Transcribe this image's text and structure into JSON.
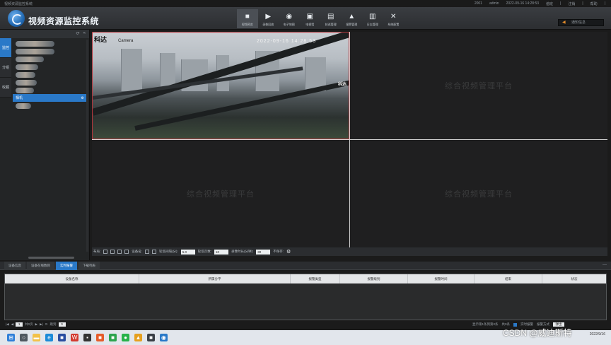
{
  "window": {
    "title": "视频资源监控系统",
    "status_items": [
      "2001",
      "admin",
      "2022-09-16 14:28:53",
      "值班",
      "|",
      "注销",
      "|",
      "帮助",
      "|"
    ]
  },
  "header": {
    "app_title": "视频资源监控系统",
    "nav": [
      {
        "label": "视频预览",
        "icon": "camera-icon"
      },
      {
        "label": "录像回放",
        "icon": "playback-icon"
      },
      {
        "label": "电子地图",
        "icon": "map-pin-icon"
      },
      {
        "label": "电视墙",
        "icon": "tv-wall-icon"
      },
      {
        "label": "轮巡管理",
        "icon": "cycle-icon"
      },
      {
        "label": "报警管理",
        "icon": "alarm-icon"
      },
      {
        "label": "日志管理",
        "icon": "log-icon"
      },
      {
        "label": "系统配置",
        "icon": "tools-icon"
      }
    ],
    "search_placeholder": "通知信息"
  },
  "left_panel": {
    "tabs": [
      "监控",
      "分组",
      "收藏"
    ],
    "selected_tree_label": "相机",
    "tree_rows": 9
  },
  "video": {
    "watermark": "综合视频管理平台",
    "live": {
      "channel": "科达",
      "camera": "Camera",
      "time": "2022-09-16 14:28:53",
      "brand": "科达"
    }
  },
  "controls": {
    "layout_label": "布局:",
    "device_label": "设备名:",
    "interval_label": "轮巡间隔(分):",
    "interval_value": "5.0",
    "pages_label": "轮巡页数:",
    "pages_value": "10",
    "duration_label": "录像时长(分钟):",
    "duration_value": "30",
    "stop_label": "不保存:"
  },
  "bottom_tabs": [
    "设备信息",
    "设备在线数目",
    "实时报警",
    "下载列表"
  ],
  "bottom_active_tab": 2,
  "table": {
    "columns": [
      "设备名称",
      "所属分平",
      "报警类型",
      "报警级别",
      "报警时间",
      "结束",
      "状态"
    ]
  },
  "pager": {
    "page": "1",
    "of_label": "共0页",
    "jump_label": "跳到",
    "page_size": "0",
    "right_items": [
      "显示第1条到第0条",
      "共0条",
      "实时报警",
      "报警方式",
      "弹出"
    ]
  },
  "taskbar": {
    "tray_date": "2022/9/16"
  },
  "watermark_text": "CSDN @威迪斯特"
}
